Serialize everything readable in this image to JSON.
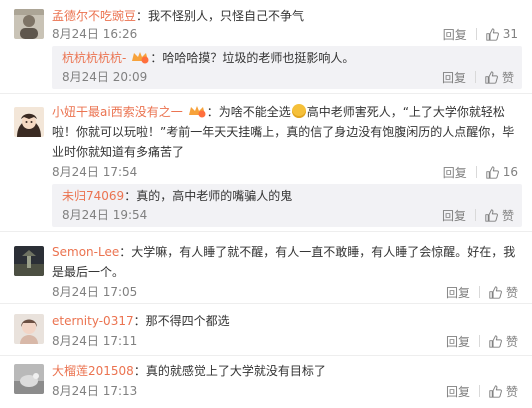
{
  "actions": {
    "reply": "回复",
    "like": "赞"
  },
  "comments": [
    {
      "user": "孟德尔不吃豌豆",
      "text": "：我不怪别人，只怪自己不争气",
      "time": "8月24日 16:26",
      "likes": "31",
      "reply": {
        "user": "杭杭杭杭杭-",
        "text": "：哈哈哈摸？垃圾的老师也挺影响人。",
        "time": "8月24日 20:09"
      }
    },
    {
      "user": "小妞干最ai西索没有之一",
      "text_a": "：为啥不能全选",
      "text_b": "高中老师害死人，“上了大学你就轻松啦！你就可以玩啦！”考前一年天天挂嘴上，真的信了身边没有饱腹闲历的人点醒你，毕业时你就知道有多痛苦了",
      "time": "8月24日 17:54",
      "likes": "16",
      "reply": {
        "user": "未归74069",
        "text": "：真的，高中老师的嘴骗人的鬼",
        "time": "8月24日 19:54"
      }
    },
    {
      "user": "Semon-Lee",
      "text": "：大学嘛，有人睡了就不醒，有人一直不敢睡，有人睡了会惊醒。好在，我是最后一个。",
      "time": "8月24日 17:05",
      "likes": ""
    },
    {
      "user": "eternity-0317",
      "text": "：那不得四个都选",
      "time": "8月24日 17:11",
      "likes": ""
    },
    {
      "user": "大榴莲201508",
      "text": "：真的就感觉上了大学就没有目标了",
      "time": "8月24日 17:13",
      "likes": ""
    }
  ],
  "colors": {
    "username": "#eb7350",
    "meta": "#808080",
    "reply_bg": "#f2f2f5"
  },
  "icons": [
    "avatar",
    "vip-badge-icon",
    "like-thumb-icon",
    "smile-emoji-icon"
  ]
}
